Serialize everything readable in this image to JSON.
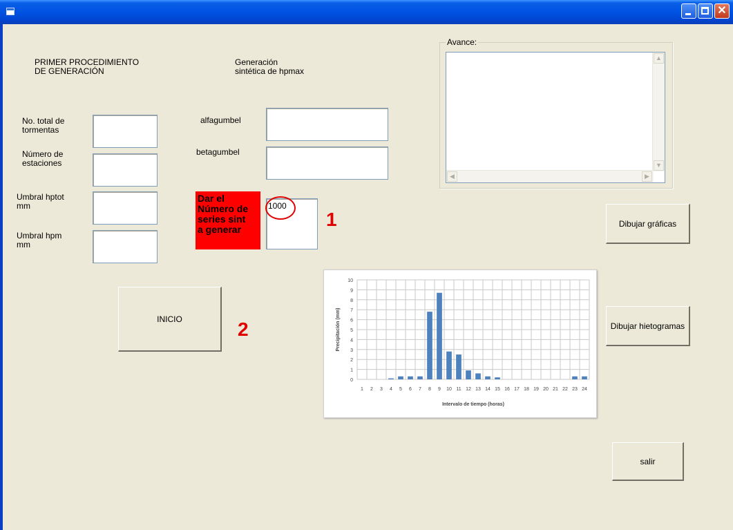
{
  "window": {
    "title": ""
  },
  "labels": {
    "heading1": "PRIMER PROCEDIMIENTO\nDE GENERACIÓN",
    "heading2": "Generación\nsintética de hpmax",
    "tormentas": "No. total de\ntormentas",
    "estaciones": "Número de\nestaciones",
    "hptot": "Umbral hptot\nmm",
    "hpm": "Umbral hpm\nmm",
    "alfagumbel": "alfagumbel",
    "betagumbel": "betagumbel",
    "dar_numero": "Dar el\nNúmero de\nseries sint\na generar"
  },
  "inputs": {
    "tormentas": "",
    "estaciones": "",
    "hptot": "",
    "hpm": "",
    "alfagumbel": "",
    "betagumbel": "",
    "series": "1000"
  },
  "avance": {
    "label": "Avance:",
    "text": ""
  },
  "buttons": {
    "inicio": "INICIO",
    "dibujar_graficas": "Dibujar gráficas",
    "dibujar_hietogramas": "Dibujar hietogramas",
    "salir": "salir"
  },
  "annotations": {
    "step1": "1",
    "step2": "2"
  },
  "colors": {
    "highlight_red": "#ff0000",
    "annotation_red": "#e00000",
    "bar_blue": "#4f81bd"
  },
  "chart_data": {
    "type": "bar",
    "categories": [
      "1",
      "2",
      "3",
      "4",
      "5",
      "6",
      "7",
      "8",
      "9",
      "10",
      "11",
      "12",
      "13",
      "14",
      "15",
      "16",
      "17",
      "18",
      "19",
      "20",
      "21",
      "22",
      "23",
      "24"
    ],
    "values": [
      0,
      0,
      0,
      0.1,
      0.3,
      0.3,
      0.3,
      6.8,
      8.7,
      2.8,
      2.5,
      0.9,
      0.6,
      0.3,
      0.2,
      0,
      0,
      0,
      0,
      0,
      0,
      0,
      0.3,
      0.3
    ],
    "xlabel": "Intervalo de tiempo (horas)",
    "ylabel": "Precipitación (mm)",
    "ylim": [
      0,
      10
    ],
    "yticks": [
      "0",
      "1",
      "2",
      "3",
      "4",
      "5",
      "6",
      "7",
      "8",
      "9",
      "10"
    ],
    "grid": true
  }
}
